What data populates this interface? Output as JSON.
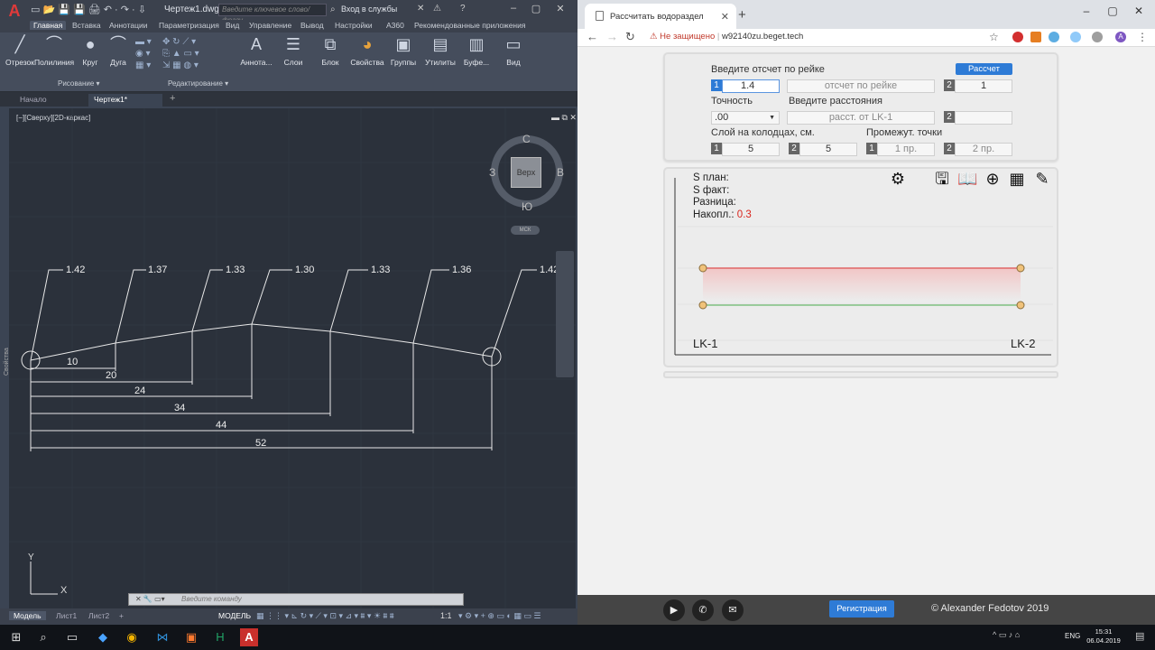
{
  "autocad": {
    "logo": "A",
    "doc_title": "Чертеж1.dwg",
    "search_placeholder": "Введите ключевое слово/фразу",
    "signin": "Вход в службы",
    "ribbon_tabs": [
      "Главная",
      "Вставка",
      "Аннотации",
      "Параметризация",
      "Вид",
      "Управление",
      "Вывод",
      "Настройки",
      "A360",
      "Рекомендованные приложения"
    ],
    "ribbon_buttons": [
      "Отрезок",
      "Полилиния",
      "Круг",
      "Дуга",
      "Аннота...",
      "Слои",
      "Блок",
      "Свойства",
      "Группы",
      "Утилиты",
      "Буфе...",
      "Вид"
    ],
    "panel_labels": [
      "Рисование",
      "Редактирование"
    ],
    "doc_tabs": [
      "Начало",
      "Чертеж1*"
    ],
    "viewport_label": "[−][Сверху][2D-каркас]",
    "viewcube": {
      "top": "Верх",
      "n": "С",
      "s": "Ю",
      "w": "З",
      "e": "В",
      "wcs": "МСК"
    },
    "elevations": [
      "1.42",
      "1.37",
      "1.33",
      "1.30",
      "1.33",
      "1.36",
      "1.42"
    ],
    "distances": [
      "10",
      "20",
      "24",
      "34",
      "44",
      "52"
    ],
    "axis_y": "Y",
    "axis_x": "X",
    "cmd_placeholder": "Введите команду",
    "layout_tabs": [
      "Модель",
      "Лист1",
      "Лист2"
    ],
    "model_label": "МОДЕЛЬ",
    "scale_label": "1:1",
    "props_side": "Свойства"
  },
  "browser": {
    "tab_title": "Рассчитать водораздел",
    "insecure_label": "Не защищено",
    "url": "w92140zu.beget.tech",
    "form": {
      "reading_label": "Введите отсчет по рейке",
      "calc_button": "Рассчет",
      "field1_num": "1",
      "field1_value": "1.4",
      "field1b_placeholder": "отсчет по рейке",
      "field2_num": "2",
      "field2_value": "1",
      "precision_label": "Точность",
      "precision_value": ".00",
      "distance_label": "Введите расстояния",
      "distance_placeholder": "расст. от LK-1",
      "distance2_num": "2",
      "layer_label": "Слой на колодцах, см.",
      "layer1_num": "1",
      "layer1_value": "5",
      "layer2_num": "2",
      "layer2_value": "5",
      "intermediate_label": "Промежут. точки",
      "pt1_num": "1",
      "pt1_placeholder": "1 пр.",
      "pt2_num": "2",
      "pt2_placeholder": "2 пр."
    },
    "results": {
      "s_plan": "S план:",
      "s_fact": "S факт:",
      "diff": "Разница:",
      "accum": "Накопл.:",
      "accum_value": "0.3",
      "left_well": "LK-1",
      "right_well": "LK-2"
    },
    "footer": {
      "register": "Регистрация",
      "copyright": "© Alexander Fedotov 2019"
    },
    "colors": {
      "accent": "#2e7bd6",
      "red_line": "#e06666",
      "green_line": "#4caf50",
      "node": "#f0c27a"
    }
  },
  "taskbar": {
    "lang": "ENG",
    "time": "15:31",
    "date": "06.04.2019"
  }
}
